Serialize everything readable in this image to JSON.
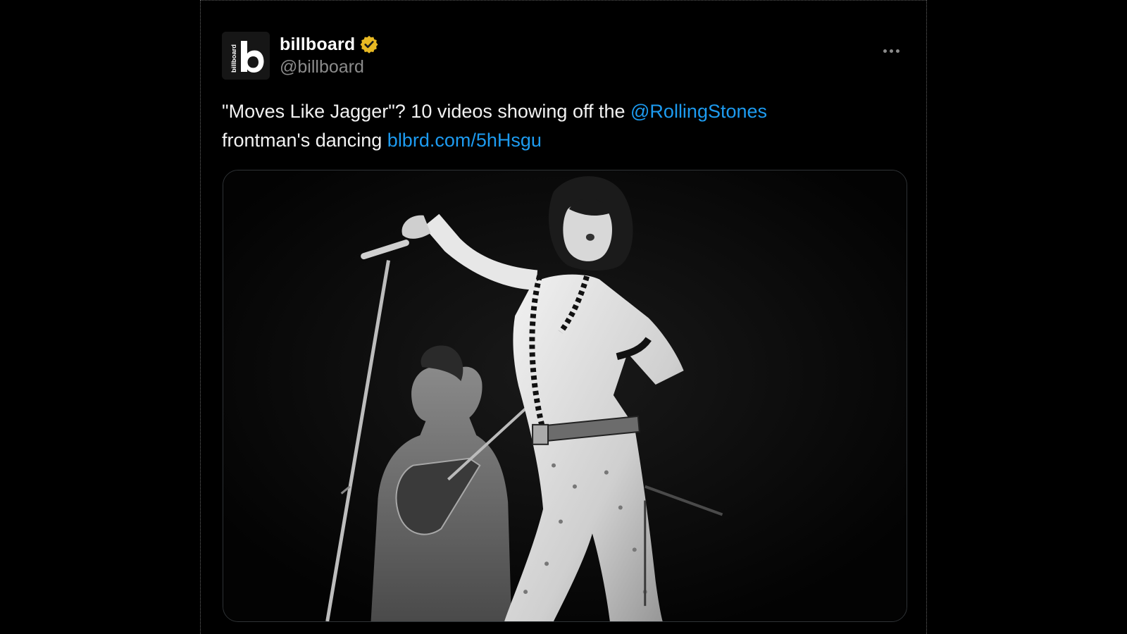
{
  "tweet": {
    "author": {
      "display_name": "billboard",
      "handle": "@billboard",
      "verified_badge_icon": "gold-verified-badge-icon",
      "avatar_logo_text": "billboard",
      "avatar_logo_letter": "b"
    },
    "more_icon": "more-options-icon",
    "text": {
      "part1": "\"Moves Like Jagger\"? 10 videos showing off the ",
      "mention": "@RollingStones",
      "part2": "frontman's dancing ",
      "link": "blbrd.com/5hHsgu"
    },
    "media_icon": "concert-photo-image"
  },
  "colors": {
    "background": "#000000",
    "link": "#1d9bf0",
    "text": "#f2f2f2",
    "handle": "#8b8b8b",
    "verified_badge": "#e8b923"
  }
}
